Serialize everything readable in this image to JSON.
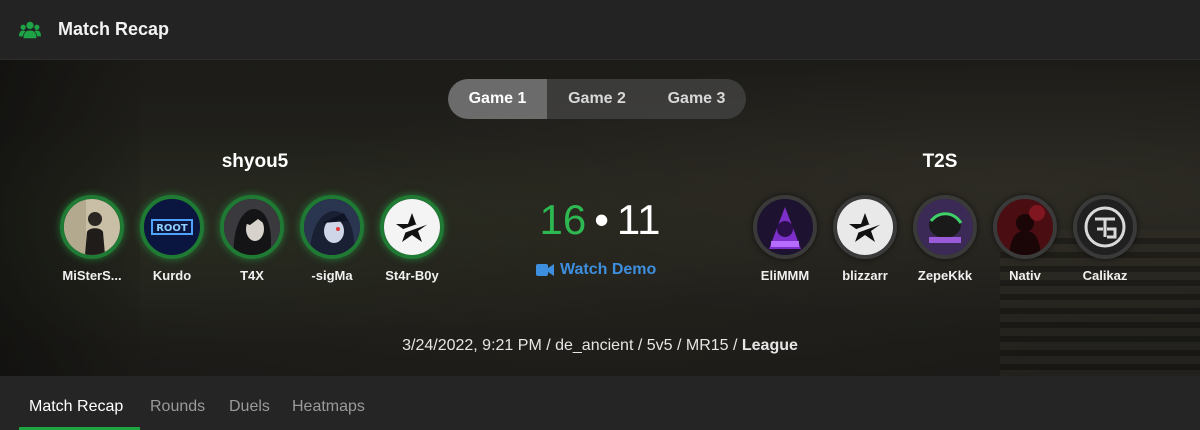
{
  "header": {
    "title": "Match Recap",
    "icon": "users-icon",
    "icon_color": "#1ea446"
  },
  "game_tabs": [
    {
      "label": "Game 1",
      "active": true
    },
    {
      "label": "Game 2",
      "active": false
    },
    {
      "label": "Game 3",
      "active": false
    }
  ],
  "team_left": {
    "name": "shyou5",
    "result": "win",
    "players": [
      {
        "name": "MiSterS..."
      },
      {
        "name": "Kurdo"
      },
      {
        "name": "T4X"
      },
      {
        "name": "-sigMa"
      },
      {
        "name": "St4r-B0y"
      }
    ]
  },
  "team_right": {
    "name": "T2S",
    "result": "lose",
    "players": [
      {
        "name": "EliMMM"
      },
      {
        "name": "blizzarr"
      },
      {
        "name": "ZepeKkk"
      },
      {
        "name": "Nativ"
      },
      {
        "name": "Calikaz"
      }
    ]
  },
  "score": {
    "left": "16",
    "separator": "•",
    "right": "11",
    "left_color": "#2eb851"
  },
  "watch_demo": {
    "label": "Watch Demo",
    "icon": "video-camera-icon",
    "color": "#3d8fe0"
  },
  "meta": {
    "text": "3/24/2022, 9:21 PM / de_ancient / 5v5 / MR15 / ",
    "mode": "League"
  },
  "subtabs": [
    {
      "label": "Match Recap",
      "active": true
    },
    {
      "label": "Rounds",
      "active": false
    },
    {
      "label": "Duels",
      "active": false
    },
    {
      "label": "Heatmaps",
      "active": false
    }
  ],
  "accent_color": "#1fa442"
}
